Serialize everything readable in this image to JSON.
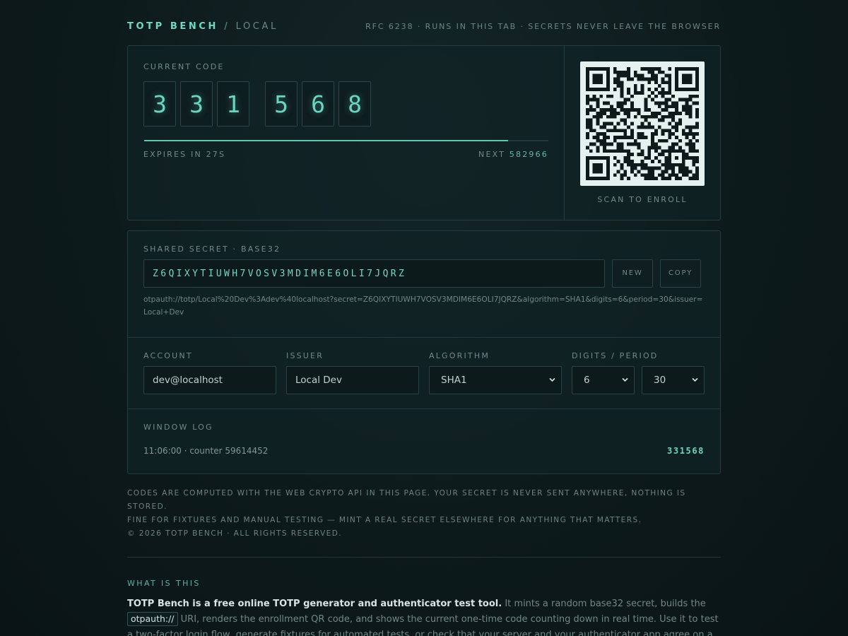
{
  "header": {
    "brand": "TOTP BENCH",
    "sep": "/",
    "env": "LOCAL",
    "tagline": "RFC 6238 · RUNS IN THIS TAB · SECRETS NEVER LEAVE THE BROWSER"
  },
  "code_panel": {
    "label": "CURRENT CODE",
    "digits": [
      "3",
      "3",
      "1",
      "5",
      "6",
      "8"
    ],
    "progress_fraction": 0.9,
    "expires_text": "EXPIRES IN 27S",
    "next_label": "NEXT",
    "next_code": "582966"
  },
  "qr": {
    "caption": "SCAN TO ENROLL"
  },
  "secret": {
    "label": "SHARED SECRET · BASE32",
    "value": "Z6QIXYTIUWH7VOSV3MDIM6E6OLI7JQRZ",
    "new_label": "NEW",
    "copy_label": "COPY",
    "uri": "otpauth://totp/Local%20Dev%3Adev%40localhost?secret=Z6QIXYTIUWH7VOSV3MDIM6E6OLI7JQRZ&algorithm=SHA1&digits=6&period=30&issuer=Local+Dev"
  },
  "fields": {
    "account_label": "ACCOUNT",
    "account_value": "dev@localhost",
    "issuer_label": "ISSUER",
    "issuer_value": "Local Dev",
    "algorithm_label": "ALGORITHM",
    "algorithm_value": "SHA1",
    "digits_period_label": "DIGITS / PERIOD",
    "digits_value": "6",
    "period_value": "30"
  },
  "log": {
    "label": "WINDOW LOG",
    "entry_left": "11:06:00 · counter 59614452",
    "entry_code": "331568"
  },
  "notes": [
    "CODES ARE COMPUTED WITH THE WEB CRYPTO API IN THIS PAGE. YOUR SECRET IS NEVER SENT ANYWHERE, NOTHING IS STORED.",
    "FINE FOR FIXTURES AND MANUAL TESTING — MINT A REAL SECRET ELSEWHERE FOR ANYTHING THAT MATTERS.",
    "© 2026 TOTP BENCH · ALL RIGHTS RESERVED."
  ],
  "about": {
    "heading": "WHAT IS THIS",
    "lead": "TOTP Bench is a free online TOTP generator and authenticator test tool.",
    "text1": " It mints a random base32 secret, builds the ",
    "code": "otpauth://",
    "text2": " URI, renders the enrollment QR code, and shows the current one-time code counting down in real time. Use it to test a two-factor login flow, generate fixtures for automated tests, or check that your server and your authenticator app agree on a code."
  },
  "colors": {
    "accent": "#6fd8c4",
    "background": "#0d1a1c",
    "card_border": "#233b3c",
    "qr_background": "#e4f1ee",
    "qr_module": "#0e1a1c"
  },
  "icons": {
    "select_arrow": "chevron-down-icon"
  }
}
